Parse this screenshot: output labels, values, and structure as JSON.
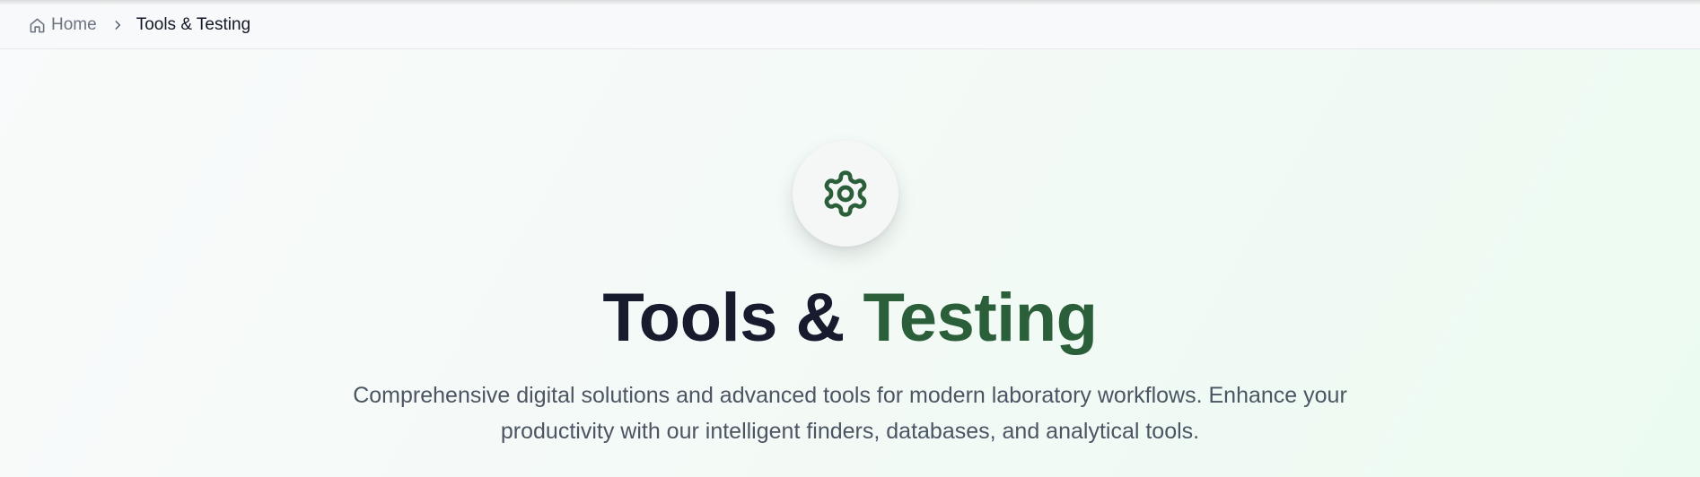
{
  "breadcrumb": {
    "home_label": "Home",
    "home_icon": "home-icon",
    "separator_icon": "chevron-right-icon",
    "current_label": "Tools & Testing"
  },
  "hero": {
    "icon": "gear-icon",
    "title_part1": "Tools &",
    "title_part2": "Testing",
    "subtitle": "Comprehensive digital solutions and advanced tools for modern laboratory workflows. Enhance your productivity with our intelligent finders, databases, and analytical tools."
  },
  "colors": {
    "accent_green": "#2b5f3a",
    "title_dark": "#161b2e",
    "muted_text": "#4b5563"
  }
}
